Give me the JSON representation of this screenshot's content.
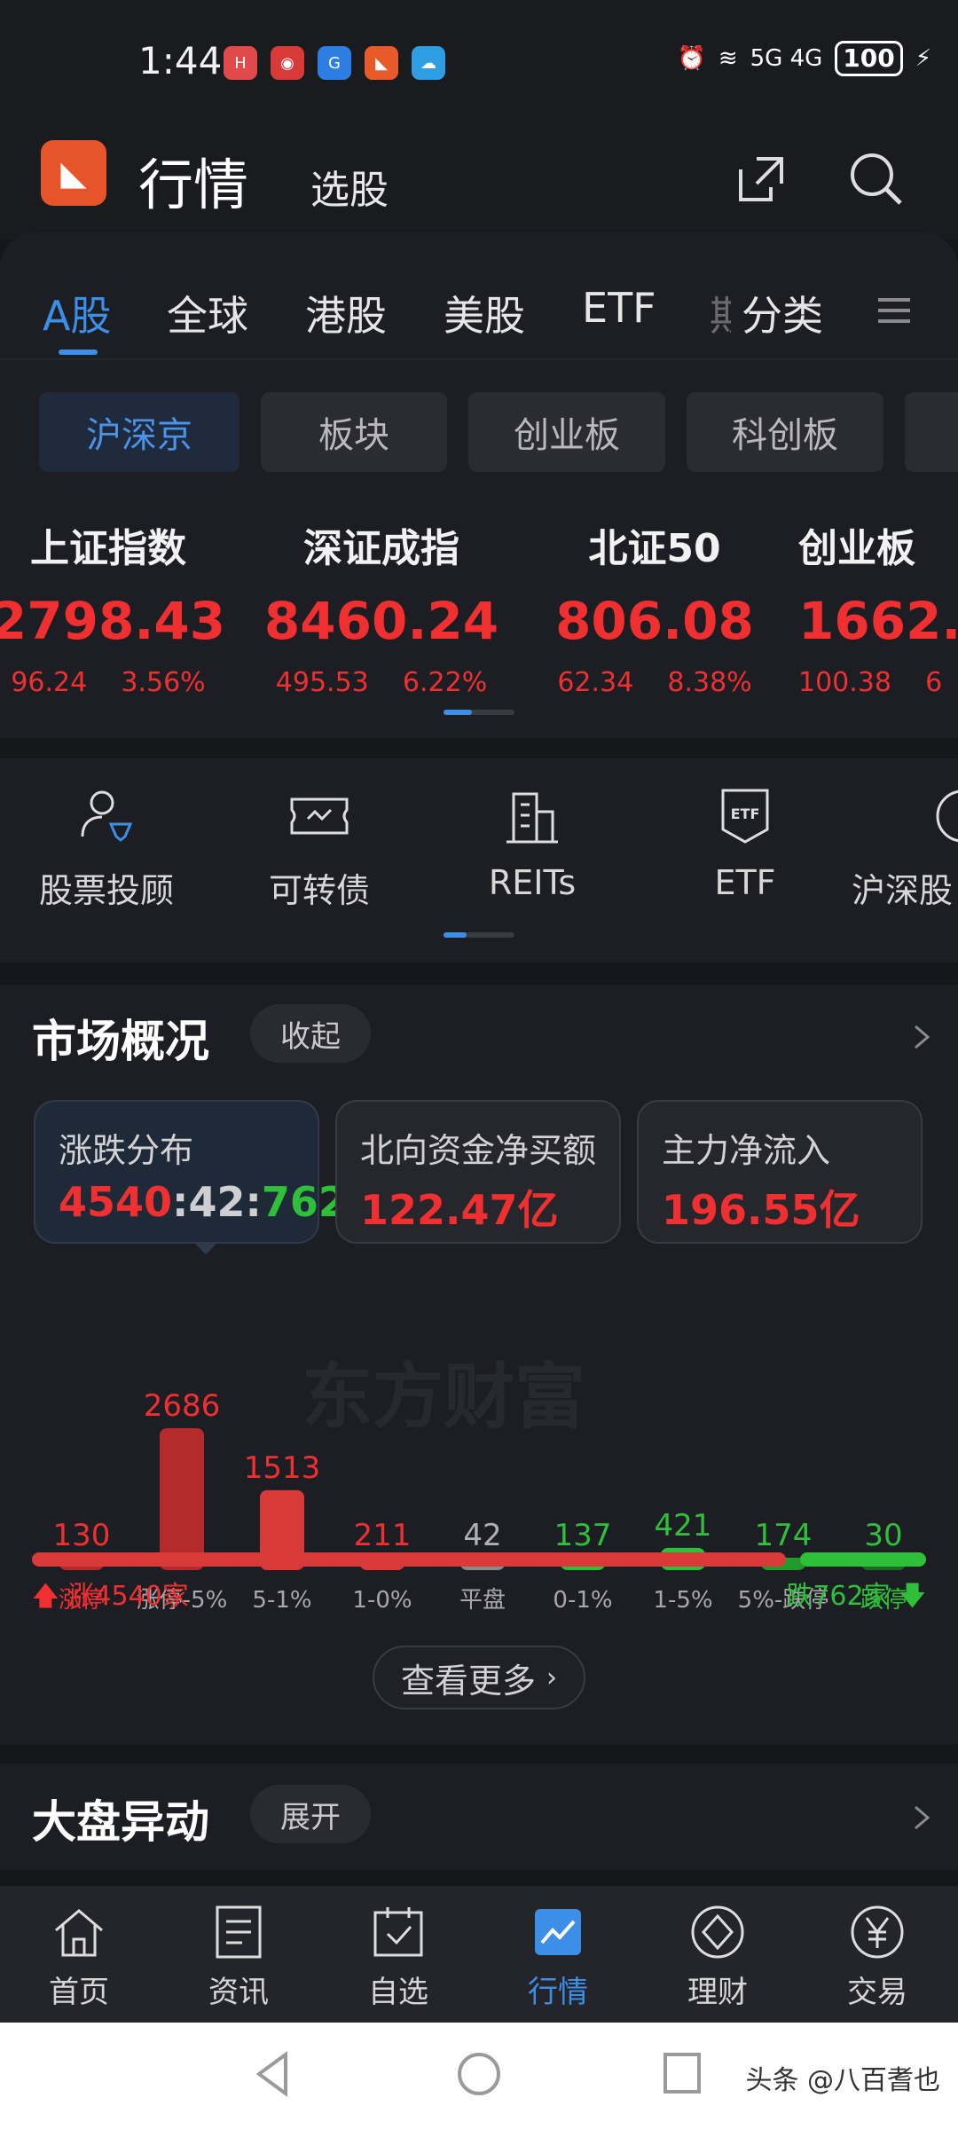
{
  "status_bar": {
    "time": "1:44",
    "network": "5G 4G",
    "battery": "100"
  },
  "app_icons": [
    {
      "name": "huawei-icon",
      "color": "#e04a4a"
    },
    {
      "name": "game-icon",
      "color": "#e04a4a"
    },
    {
      "name": "browser-icon",
      "color": "#2e7de2"
    },
    {
      "name": "eastmoney-icon",
      "color": "#e85a2a"
    },
    {
      "name": "cloud-icon",
      "color": "#2e9de2"
    }
  ],
  "header": {
    "logo_text": "东方财富",
    "title": "行情",
    "subtitle": "选股"
  },
  "tabs": [
    "A股",
    "全球",
    "港股",
    "美股",
    "ETF",
    "期",
    "分类"
  ],
  "chips": [
    "沪深京",
    "板块",
    "创业板",
    "科创板"
  ],
  "indices": [
    {
      "name": "上证指数",
      "value": "2798.43",
      "change": "96.24",
      "pct": "3.56%"
    },
    {
      "name": "深证成指",
      "value": "8460.24",
      "change": "495.53",
      "pct": "6.22%"
    },
    {
      "name": "北证50",
      "value": "806.08",
      "change": "62.34",
      "pct": "8.38%"
    },
    {
      "name": "创业板",
      "value": "1662.",
      "change": "100.38",
      "pct": "6"
    }
  ],
  "quick_links": [
    "股票投顾",
    "可转债",
    "REITs",
    "ETF",
    "沪深股"
  ],
  "market": {
    "title": "市场概况",
    "collapse_label": "收起",
    "cards": [
      {
        "title": "涨跌分布",
        "up": "4540",
        "flat": "42",
        "down": "762"
      },
      {
        "title": "北向资金净买额",
        "value": "122.47亿"
      },
      {
        "title": "主力净流入",
        "value": "196.55亿"
      }
    ],
    "watermark": "东方财富",
    "up_summary": "涨4540家",
    "down_summary": "跌762家",
    "more_label": "查看更多"
  },
  "chart_data": {
    "type": "bar",
    "categories": [
      "涨停",
      "涨停-5%",
      "5-1%",
      "1-0%",
      "平盘",
      "0-1%",
      "1-5%",
      "5%-跌停",
      "跌停"
    ],
    "values": [
      130,
      2686,
      1513,
      211,
      42,
      137,
      421,
      174,
      30
    ],
    "colors": [
      "#b52b2b",
      "#b52b2b",
      "#d83a3a",
      "#d83a3a",
      "#8a8a8a",
      "#2fbf3a",
      "#2fbf3a",
      "#1f9a2b",
      "#1a6a22"
    ],
    "ups": 4540,
    "downs": 762
  },
  "abnormal": {
    "title": "大盘异动",
    "expand_label": "展开"
  },
  "bottom_nav": [
    "首页",
    "资讯",
    "自选",
    "行情",
    "理财",
    "交易"
  ],
  "watermark": "头条 @八百耆也"
}
